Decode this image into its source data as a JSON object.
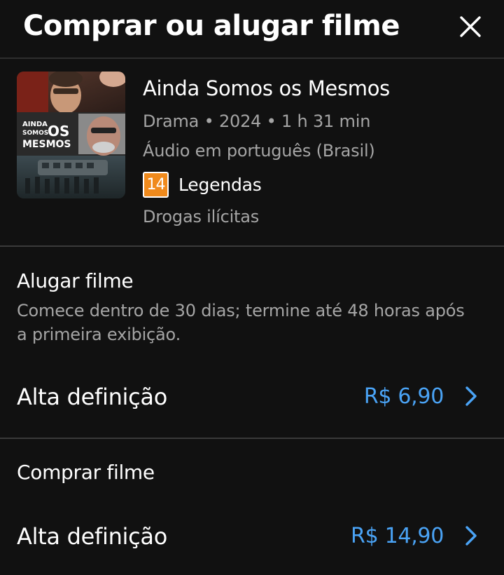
{
  "header": {
    "title": "Comprar ou alugar filme",
    "close_icon": "close-icon"
  },
  "movie": {
    "title": "Ainda Somos os Mesmos",
    "genre_line": "Drama • 2024 • 1 h 31 min",
    "audio": "Áudio em português (Brasil)",
    "rating": "14",
    "subtitles": "Legendas",
    "content_warning": "Drogas ilícitas",
    "poster": {
      "title_lines": [
        "AINDA",
        "SOMOS",
        "OS",
        "MESMOS"
      ]
    }
  },
  "rent": {
    "title": "Alugar filme",
    "description": "Comece dentro de 30 dias; termine até 48 horas após a primeira exibição.",
    "option": {
      "label": "Alta definição",
      "price": "R$ 6,90"
    }
  },
  "buy": {
    "title": "Comprar filme",
    "option": {
      "label": "Alta definição",
      "price": "R$ 14,90"
    }
  },
  "colors": {
    "background": "#111111",
    "price_accent": "#4aa3f5",
    "rating_badge": "#f08a1c",
    "secondary_text": "#a5a5a5"
  }
}
